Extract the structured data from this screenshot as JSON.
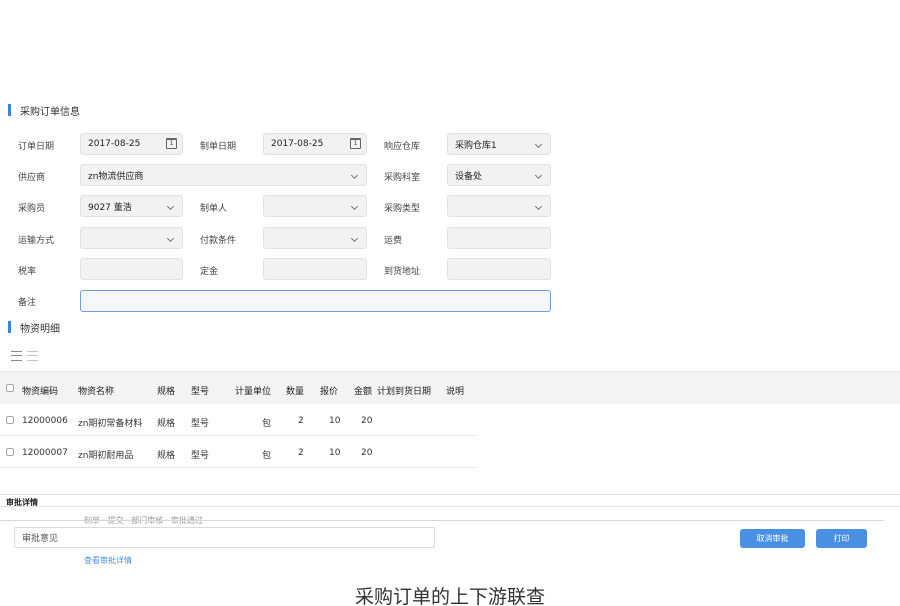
{
  "sections": {
    "order_info": "采购订单信息",
    "material_detail": "物资明细"
  },
  "form": {
    "order_date": {
      "label": "订单日期",
      "value": "2017-08-25"
    },
    "create_date": {
      "label": "制单日期",
      "value": "2017-08-25"
    },
    "warehouse": {
      "label": "响应仓库",
      "value": "采购仓库1"
    },
    "supplier": {
      "label": "供应商",
      "value": "zn物流供应商"
    },
    "dept": {
      "label": "采购科室",
      "value": "设备处"
    },
    "buyer": {
      "label": "采购员",
      "value": "9027 董浩"
    },
    "creator": {
      "label": "制单人",
      "value": ""
    },
    "purchase_type": {
      "label": "采购类型",
      "value": ""
    },
    "transport": {
      "label": "运输方式",
      "value": ""
    },
    "pay_terms": {
      "label": "付款条件",
      "value": ""
    },
    "freight": {
      "label": "运费",
      "value": ""
    },
    "tax_rate": {
      "label": "税率",
      "value": ""
    },
    "deposit": {
      "label": "定金",
      "value": ""
    },
    "address": {
      "label": "到货地址",
      "value": ""
    },
    "remark": {
      "label": "备注",
      "value": ""
    }
  },
  "table": {
    "headers": [
      "物资编码",
      "物资名称",
      "规格",
      "型号",
      "计量单位",
      "数量",
      "报价",
      "金额",
      "计划到货日期",
      "说明"
    ],
    "rows": [
      {
        "code": "12000006",
        "name": "zn期初常备材料",
        "spec": "规格",
        "model": "型号",
        "unit": "包",
        "qty": "2",
        "price": "10",
        "amount": "20"
      },
      {
        "code": "12000007",
        "name": "zn期初耐用品",
        "spec": "规格",
        "model": "型号",
        "unit": "包",
        "qty": "2",
        "price": "10",
        "amount": "20"
      }
    ]
  },
  "approval": {
    "title": "审批详情",
    "ghost_top": "制单 · 提交 · 部门审核 · 审批通过",
    "ghost_bottom": "查看审批详情",
    "opinion_placeholder": "审批意见",
    "cancel_btn": "取消审批",
    "print_btn": "打印"
  },
  "caption": "采购订单的上下游联查"
}
